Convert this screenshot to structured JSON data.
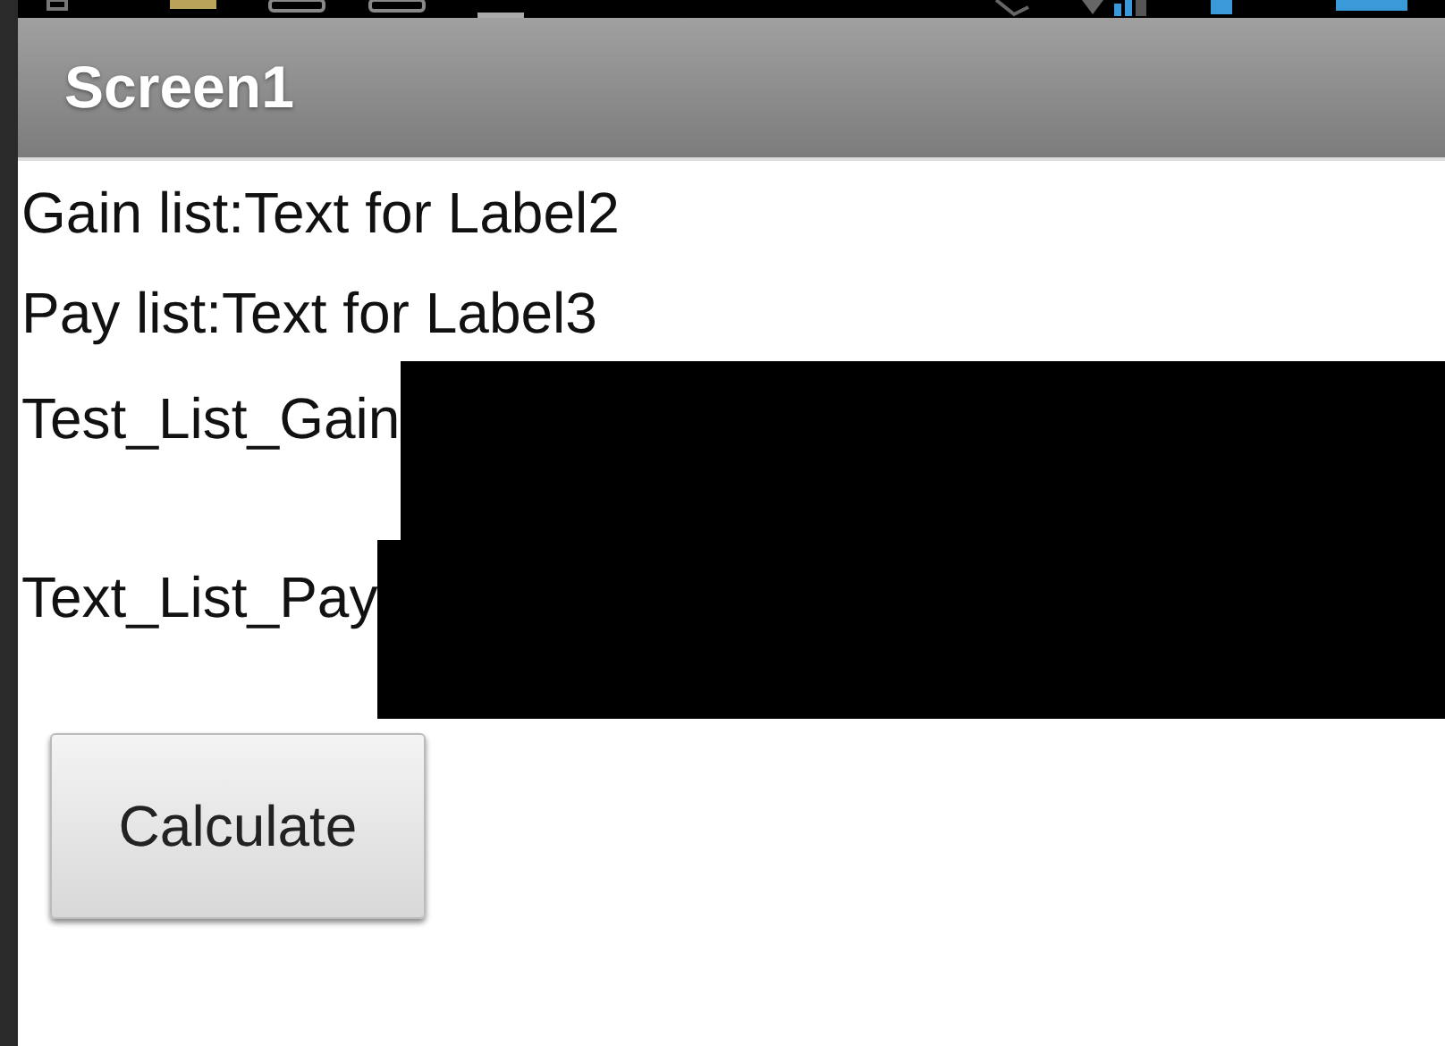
{
  "title_bar": {
    "title": "Screen1"
  },
  "labels": [
    "Gain list:Text for Label2",
    "Pay list:Text for Label3"
  ],
  "list_rows": [
    {
      "label": "Test_List_Gain",
      "kind": "redacted"
    },
    {
      "label": "Text_List_Pay",
      "kind": "redacted"
    }
  ],
  "button": {
    "label": "Calculate"
  }
}
